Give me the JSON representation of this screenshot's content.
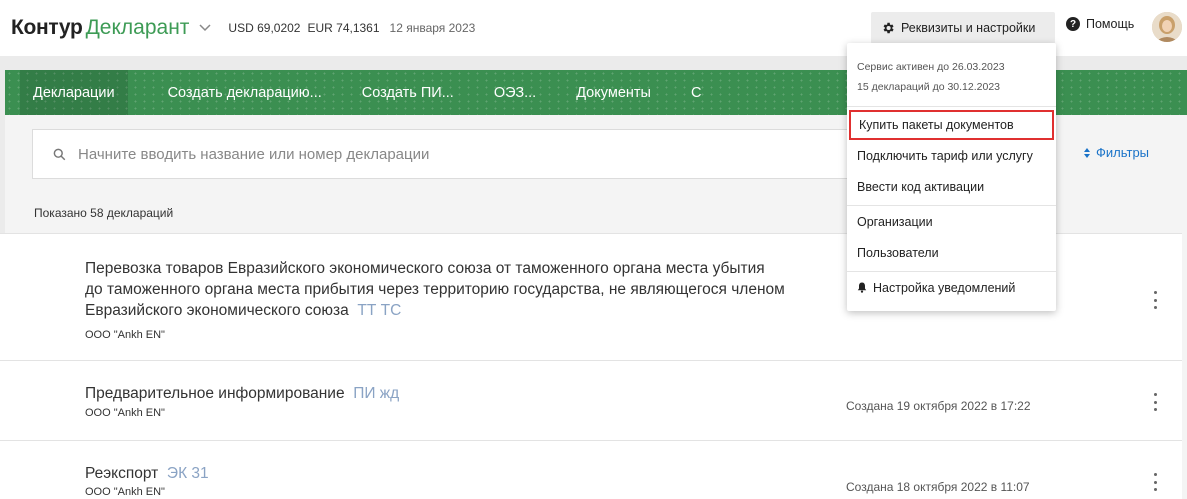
{
  "header": {
    "brand": "Контур",
    "product": "Декларант",
    "usd": "USD 69,0202",
    "eur": "EUR 74,1361",
    "date": "12 января 2023",
    "settings_label": "Реквизиты и настройки",
    "help_label": "Помощь"
  },
  "nav": {
    "items": [
      "Декларации",
      "Создать декларацию...",
      "Создать ПИ...",
      "ОЭЗ...",
      "Документы",
      "С"
    ]
  },
  "search": {
    "placeholder": "Начните вводить название или номер декларации",
    "filters_label": "Фильтры"
  },
  "list": {
    "shown_text": "Показано 58 деклараций",
    "rows": [
      {
        "title": "Перевозка товаров Евразийского экономического союза от таможенного органа места убытия до таможенного органа места прибытия через территорию государства, не являющегося членом Евразийского экономического союза",
        "tag": "ТТ ТС",
        "org": "ООО \"Ankh EN\"",
        "created": ""
      },
      {
        "title": "Предварительное информирование",
        "tag": "ПИ жд",
        "org": "ООО \"Ankh EN\"",
        "created": "Создана 19 октября 2022 в 17:22"
      },
      {
        "title": "Реэкспорт",
        "tag": "ЭК 31",
        "org": "ООО \"Ankh EN\"",
        "created": "Создана 18 октября 2022 в 11:07"
      }
    ]
  },
  "dropdown": {
    "info_line1": "Сервис активен до 26.03.2023",
    "info_line2": "15 деклараций до 30.12.2023",
    "items": [
      "Купить пакеты документов",
      "Подключить тариф или услугу",
      "Ввести код активации",
      "Организации",
      "Пользователи",
      "Настройка уведомлений"
    ]
  },
  "colors": {
    "brand_green": "#3d9b55",
    "nav_green": "#3b8f51",
    "link_blue": "#1a73c8",
    "highlight_red": "#e03030"
  }
}
